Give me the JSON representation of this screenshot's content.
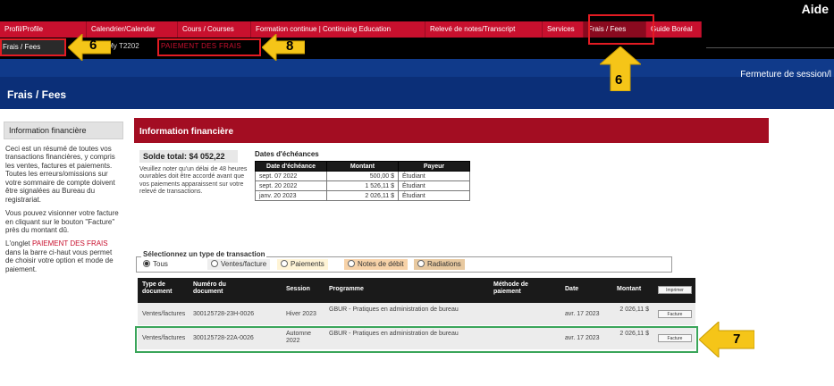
{
  "header": {
    "aide": "Aide",
    "tabs": [
      {
        "label": "Profil/Profile"
      },
      {
        "label": "Calendrier/Calendar"
      },
      {
        "label": "Cours / Courses"
      },
      {
        "label": "Formation continue | Continuing Education"
      },
      {
        "label": "Relevé de notes/Transcript"
      },
      {
        "label": "Services"
      },
      {
        "label": "Frais / Fees",
        "active": true
      },
      {
        "label": "Guide Boréal"
      }
    ],
    "subnav_active": "Frais / Fees",
    "subnav_user": "/My T2202",
    "subnav_pay": "PAIEMENT DES FRAIS",
    "fermeture": "Fermeture de session/l"
  },
  "page_title": "Frais / Fees",
  "sidebar": {
    "heading": "Information financière",
    "p1": "Ceci est un résumé de toutes vos transactions financières, y compris les ventes, factures et paiements. Toutes les erreurs/omissions sur votre sommaire de compte doivent être signalées au Bureau du registrariat.",
    "p2": "Vous pouvez visionner votre facture en cliquant sur le bouton \"Facture\" près du montant dû.",
    "p3_pre": "L'onglet ",
    "p3_link": "PAIEMENT DES FRAIS",
    "p3_post": " dans la barre ci-haut vous permet de choisir votre option et mode de paiement."
  },
  "main": {
    "heading": "Information financière",
    "solde": "Solde total: $4 052,22",
    "solde_note": "Veuillez noter qu'un délai de 48 heures ouvrables doit être accordé avant que vos paiements apparaissent sur votre relevé de transactions.",
    "due_title": "Dates d'échéances",
    "due_headers": [
      "Date d'échéance",
      "Montant",
      "Payeur"
    ],
    "due_rows": [
      [
        "sept. 07 2022",
        "500,00 $",
        "Étudiant"
      ],
      [
        "sept. 20 2022",
        "1 526,11 $",
        "Étudiant"
      ],
      [
        "janv. 20 2023",
        "2 026,11 $",
        "Étudiant"
      ]
    ],
    "trans_legend": "Sélectionnez un type de transaction",
    "trans_options": [
      "Tous",
      "Ventes/facture",
      "Paiements",
      "Notes de débit",
      "Radiations"
    ],
    "doc_headers": {
      "type": "Type de document",
      "num": "Numéro du document",
      "session": "Session",
      "programme": "Programme",
      "methode": "Méthode de paiement",
      "date": "Date",
      "montant": "Montant",
      "print": "Imprimer"
    },
    "doc_rows": [
      {
        "type": "Ventes/factures",
        "num": "300125728-23H-0026",
        "session": "Hiver 2023",
        "programme": "GBUR - Pratiques en administration de bureau",
        "date": "avr. 17 2023",
        "montant": "2 026,11 $",
        "btn": "Facture"
      },
      {
        "type": "Ventes/factures",
        "num": "300125728-22A-0026",
        "session": "Automne 2022",
        "programme": "GBUR - Pratiques en administration de bureau",
        "date": "avr. 17 2023",
        "montant": "2 026,11 $",
        "btn": "Facture"
      }
    ]
  },
  "annotations": {
    "n6a": "6",
    "n8": "8",
    "n6b": "6",
    "n7": "7"
  },
  "colors": {
    "red": "#c8102e",
    "blue": "#0b2f78",
    "annotation_red": "#e31b23",
    "annotation_green": "#3aa55a",
    "arrow_yellow": "#f5c518"
  }
}
